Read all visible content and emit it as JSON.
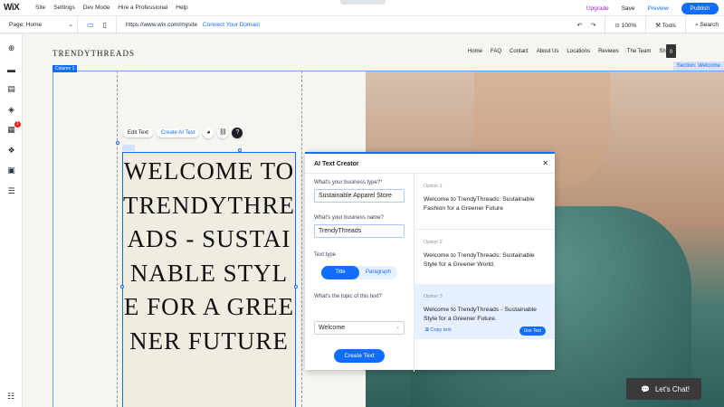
{
  "topbar": {
    "logo": "WiX",
    "menu": [
      "Site",
      "Settings",
      "Dev Mode",
      "Hire a Professional",
      "Help"
    ],
    "upgrade": "Upgrade",
    "save": "Save",
    "preview": "Preview",
    "publish": "Publish"
  },
  "toolbar": {
    "page_selector": "Page: Home",
    "url": "https://www.wix.com/mysite",
    "connect_domain": "Connect Your Domain",
    "zoom": "100%",
    "tools": "Tools",
    "search": "Search"
  },
  "site": {
    "brand": "TRENDYTHREADS",
    "nav": [
      "Home",
      "FAQ",
      "Contact",
      "About Us",
      "Locations",
      "Reviews",
      "The Team",
      "Shop"
    ],
    "cart_count": "0",
    "column_label": "Column 1",
    "section_label": "Section: Welcome",
    "headline": "WELCOME TO TRENDYTHREADS - SUSTAINABLE STYLE FOR A GREENER FUTURE"
  },
  "text_toolbar": {
    "edit_text": "Edit Text",
    "create_ai_text": "Create AI Text"
  },
  "ai_panel": {
    "title": "AI Text Creator",
    "business_type_label": "What's your business type?*",
    "business_type_value": "Sustainable Apparel Store",
    "business_name_label": "What's your business name?",
    "business_name_value": "TrendyThreads",
    "text_type_label": "Text type",
    "text_type_options": [
      "Title",
      "Paragraph"
    ],
    "topic_label": "What's the topic of this text?",
    "topic_value": "Welcome",
    "create_button": "Create Text",
    "options": [
      {
        "label": "Option 1",
        "text": "Welcome to TrendyThreads: Sustainable Fashion for a Greener Future"
      },
      {
        "label": "Option 2",
        "text": "Welcome to TrendyThreads: Sustainable Style for a Greener World."
      },
      {
        "label": "Option 3",
        "text": "Welcome to TrendyThreads - Sustainable Style for a Greener Future."
      }
    ],
    "copy_text": "Copy text",
    "use_text": "Use Text"
  },
  "chat": {
    "label": "Let's Chat!"
  }
}
